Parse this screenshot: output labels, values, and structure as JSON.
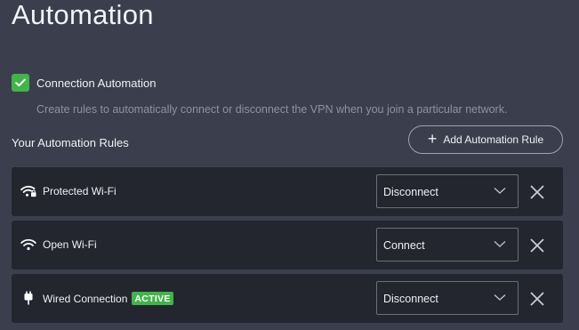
{
  "page": {
    "title": "Automation"
  },
  "connection_automation": {
    "label": "Connection Automation",
    "checked": true,
    "description": "Create rules to automatically connect or disconnect the VPN when you join a particular network."
  },
  "rules_section": {
    "title": "Your Automation Rules",
    "add_button_label": "Add Automation Rule"
  },
  "rules": [
    {
      "label": "Protected Wi-Fi",
      "icon": "wifi-lock-icon",
      "action": "Disconnect",
      "badge": ""
    },
    {
      "label": "Open Wi-Fi",
      "icon": "wifi-icon",
      "action": "Connect",
      "badge": ""
    },
    {
      "label": "Wired Connection",
      "icon": "ethernet-icon",
      "action": "Disconnect",
      "badge": "ACTIVE"
    }
  ],
  "colors": {
    "background": "#3b3f4d",
    "row_background": "#23262f",
    "accent_green": "#43b34b",
    "muted_text": "#8d929e"
  }
}
